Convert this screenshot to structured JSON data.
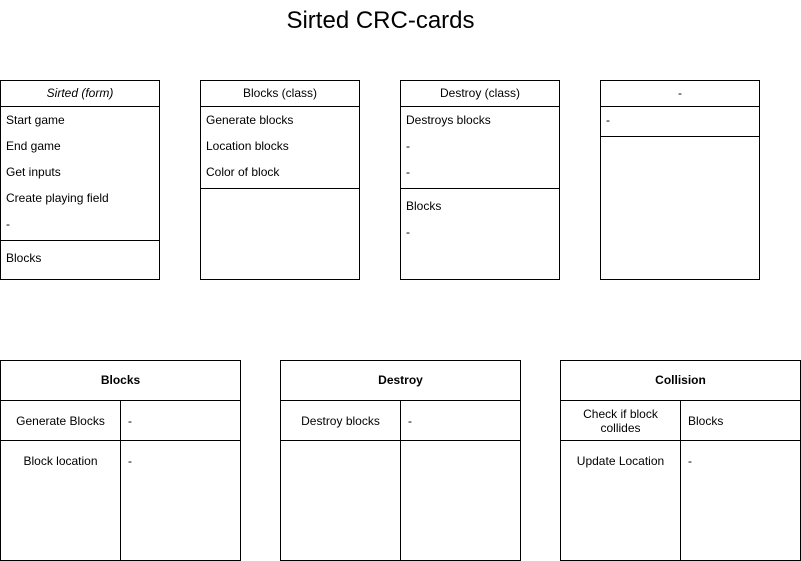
{
  "title": "Sirted CRC-cards",
  "cards": [
    {
      "header": "Sirted (form)",
      "responsibilities": [
        "Start game",
        "End game",
        "Get inputs",
        "Create playing field",
        "-"
      ],
      "collaborators": [
        "Blocks"
      ]
    },
    {
      "header": "Blocks (class)",
      "responsibilities": [
        "Generate blocks",
        "Location blocks",
        "Color of block"
      ],
      "collaborators": []
    },
    {
      "header": "Destroy (class)",
      "responsibilities": [
        "Destroys blocks",
        "-",
        "-"
      ],
      "collaborators": [
        "Blocks",
        "-"
      ]
    },
    {
      "header": "-",
      "responsibilities": [
        "-"
      ],
      "collaborators": []
    }
  ],
  "tables": [
    {
      "header": "Blocks",
      "rows": [
        {
          "left": "Generate Blocks",
          "right": "-"
        },
        {
          "left": "Block location",
          "right": "-"
        }
      ]
    },
    {
      "header": "Destroy",
      "rows": [
        {
          "left": "Destroy blocks",
          "right": "-"
        },
        {
          "left": "",
          "right": ""
        }
      ]
    },
    {
      "header": "Collision",
      "rows": [
        {
          "left": "Check if block collides",
          "right": "Blocks"
        },
        {
          "left": "Update Location",
          "right": "-"
        }
      ]
    }
  ]
}
